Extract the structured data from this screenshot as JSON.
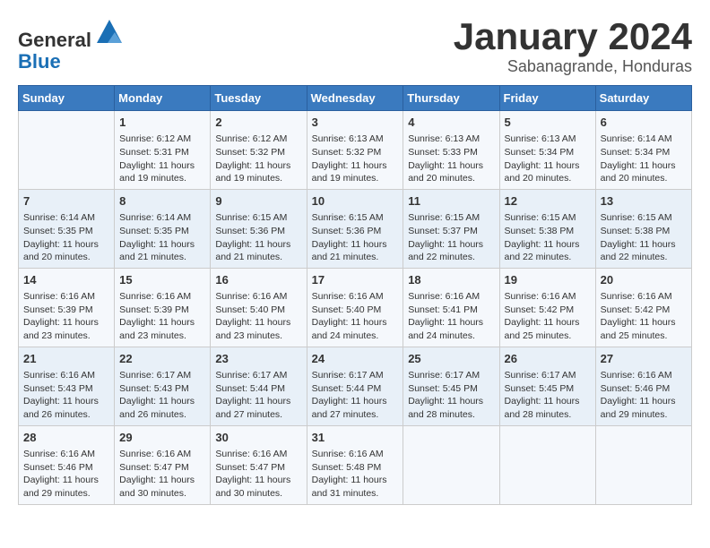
{
  "header": {
    "logo_general": "General",
    "logo_blue": "Blue",
    "month_title": "January 2024",
    "subtitle": "Sabanagrande, Honduras"
  },
  "days_of_week": [
    "Sunday",
    "Monday",
    "Tuesday",
    "Wednesday",
    "Thursday",
    "Friday",
    "Saturday"
  ],
  "weeks": [
    [
      {
        "day": "",
        "content": ""
      },
      {
        "day": "1",
        "content": "Sunrise: 6:12 AM\nSunset: 5:31 PM\nDaylight: 11 hours\nand 19 minutes."
      },
      {
        "day": "2",
        "content": "Sunrise: 6:12 AM\nSunset: 5:32 PM\nDaylight: 11 hours\nand 19 minutes."
      },
      {
        "day": "3",
        "content": "Sunrise: 6:13 AM\nSunset: 5:32 PM\nDaylight: 11 hours\nand 19 minutes."
      },
      {
        "day": "4",
        "content": "Sunrise: 6:13 AM\nSunset: 5:33 PM\nDaylight: 11 hours\nand 20 minutes."
      },
      {
        "day": "5",
        "content": "Sunrise: 6:13 AM\nSunset: 5:34 PM\nDaylight: 11 hours\nand 20 minutes."
      },
      {
        "day": "6",
        "content": "Sunrise: 6:14 AM\nSunset: 5:34 PM\nDaylight: 11 hours\nand 20 minutes."
      }
    ],
    [
      {
        "day": "7",
        "content": "Sunrise: 6:14 AM\nSunset: 5:35 PM\nDaylight: 11 hours\nand 20 minutes."
      },
      {
        "day": "8",
        "content": "Sunrise: 6:14 AM\nSunset: 5:35 PM\nDaylight: 11 hours\nand 21 minutes."
      },
      {
        "day": "9",
        "content": "Sunrise: 6:15 AM\nSunset: 5:36 PM\nDaylight: 11 hours\nand 21 minutes."
      },
      {
        "day": "10",
        "content": "Sunrise: 6:15 AM\nSunset: 5:36 PM\nDaylight: 11 hours\nand 21 minutes."
      },
      {
        "day": "11",
        "content": "Sunrise: 6:15 AM\nSunset: 5:37 PM\nDaylight: 11 hours\nand 22 minutes."
      },
      {
        "day": "12",
        "content": "Sunrise: 6:15 AM\nSunset: 5:38 PM\nDaylight: 11 hours\nand 22 minutes."
      },
      {
        "day": "13",
        "content": "Sunrise: 6:15 AM\nSunset: 5:38 PM\nDaylight: 11 hours\nand 22 minutes."
      }
    ],
    [
      {
        "day": "14",
        "content": "Sunrise: 6:16 AM\nSunset: 5:39 PM\nDaylight: 11 hours\nand 23 minutes."
      },
      {
        "day": "15",
        "content": "Sunrise: 6:16 AM\nSunset: 5:39 PM\nDaylight: 11 hours\nand 23 minutes."
      },
      {
        "day": "16",
        "content": "Sunrise: 6:16 AM\nSunset: 5:40 PM\nDaylight: 11 hours\nand 23 minutes."
      },
      {
        "day": "17",
        "content": "Sunrise: 6:16 AM\nSunset: 5:40 PM\nDaylight: 11 hours\nand 24 minutes."
      },
      {
        "day": "18",
        "content": "Sunrise: 6:16 AM\nSunset: 5:41 PM\nDaylight: 11 hours\nand 24 minutes."
      },
      {
        "day": "19",
        "content": "Sunrise: 6:16 AM\nSunset: 5:42 PM\nDaylight: 11 hours\nand 25 minutes."
      },
      {
        "day": "20",
        "content": "Sunrise: 6:16 AM\nSunset: 5:42 PM\nDaylight: 11 hours\nand 25 minutes."
      }
    ],
    [
      {
        "day": "21",
        "content": "Sunrise: 6:16 AM\nSunset: 5:43 PM\nDaylight: 11 hours\nand 26 minutes."
      },
      {
        "day": "22",
        "content": "Sunrise: 6:17 AM\nSunset: 5:43 PM\nDaylight: 11 hours\nand 26 minutes."
      },
      {
        "day": "23",
        "content": "Sunrise: 6:17 AM\nSunset: 5:44 PM\nDaylight: 11 hours\nand 27 minutes."
      },
      {
        "day": "24",
        "content": "Sunrise: 6:17 AM\nSunset: 5:44 PM\nDaylight: 11 hours\nand 27 minutes."
      },
      {
        "day": "25",
        "content": "Sunrise: 6:17 AM\nSunset: 5:45 PM\nDaylight: 11 hours\nand 28 minutes."
      },
      {
        "day": "26",
        "content": "Sunrise: 6:17 AM\nSunset: 5:45 PM\nDaylight: 11 hours\nand 28 minutes."
      },
      {
        "day": "27",
        "content": "Sunrise: 6:16 AM\nSunset: 5:46 PM\nDaylight: 11 hours\nand 29 minutes."
      }
    ],
    [
      {
        "day": "28",
        "content": "Sunrise: 6:16 AM\nSunset: 5:46 PM\nDaylight: 11 hours\nand 29 minutes."
      },
      {
        "day": "29",
        "content": "Sunrise: 6:16 AM\nSunset: 5:47 PM\nDaylight: 11 hours\nand 30 minutes."
      },
      {
        "day": "30",
        "content": "Sunrise: 6:16 AM\nSunset: 5:47 PM\nDaylight: 11 hours\nand 30 minutes."
      },
      {
        "day": "31",
        "content": "Sunrise: 6:16 AM\nSunset: 5:48 PM\nDaylight: 11 hours\nand 31 minutes."
      },
      {
        "day": "",
        "content": ""
      },
      {
        "day": "",
        "content": ""
      },
      {
        "day": "",
        "content": ""
      }
    ]
  ]
}
